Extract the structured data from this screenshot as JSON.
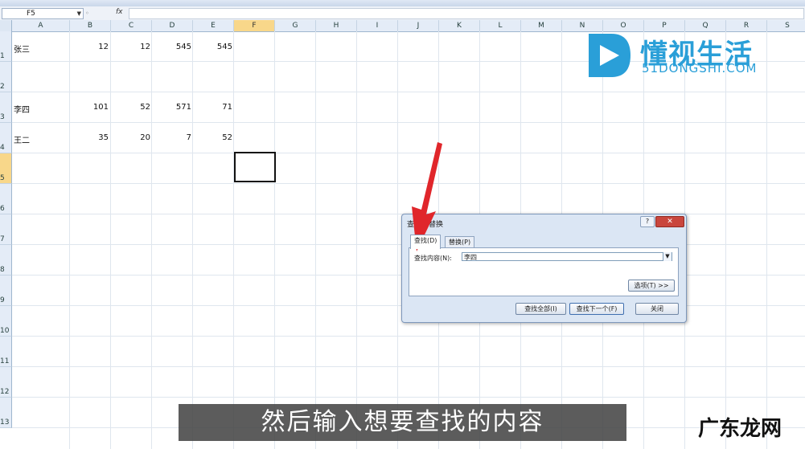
{
  "formula_bar": {
    "name_box": "F5",
    "fx": "fx",
    "value": ""
  },
  "columns": [
    "A",
    "B",
    "C",
    "D",
    "E",
    "F",
    "G",
    "H",
    "I",
    "J",
    "K",
    "L",
    "M",
    "N",
    "O",
    "P",
    "Q",
    "R",
    "S"
  ],
  "rows": [
    "1",
    "2",
    "3",
    "4",
    "5",
    "6",
    "7",
    "8",
    "9",
    "10",
    "11",
    "12",
    "13"
  ],
  "cells": [
    {
      "name": "张三",
      "b": "12",
      "c": "12",
      "d": "545",
      "e": "545"
    },
    {
      "name": "",
      "b": "",
      "c": "",
      "d": "",
      "e": ""
    },
    {
      "name": "李四",
      "b": "101",
      "c": "52",
      "d": "571",
      "e": "71"
    },
    {
      "name": "王二",
      "b": "35",
      "c": "20",
      "d": "7",
      "e": "52"
    }
  ],
  "watermark": {
    "title": "懂视生活",
    "subtitle": "51DONGSHI.COM"
  },
  "dialog": {
    "title": "查找和替换",
    "help": "?",
    "close": "✕",
    "tabs": [
      "查找(D)",
      "替换(P)"
    ],
    "find_label": "查找内容(N):",
    "find_value": "李四",
    "options_button": "选项(T) >>",
    "buttons": [
      "查找全部(I)",
      "查找下一个(F)",
      "关闭"
    ]
  },
  "subtitle": "然后输入想要查找的内容",
  "corner_brand": "广东龙网",
  "colors": {
    "arrow": "#e0262b",
    "logo": "#2a9fd8",
    "selected_header": "#f8d78a"
  }
}
